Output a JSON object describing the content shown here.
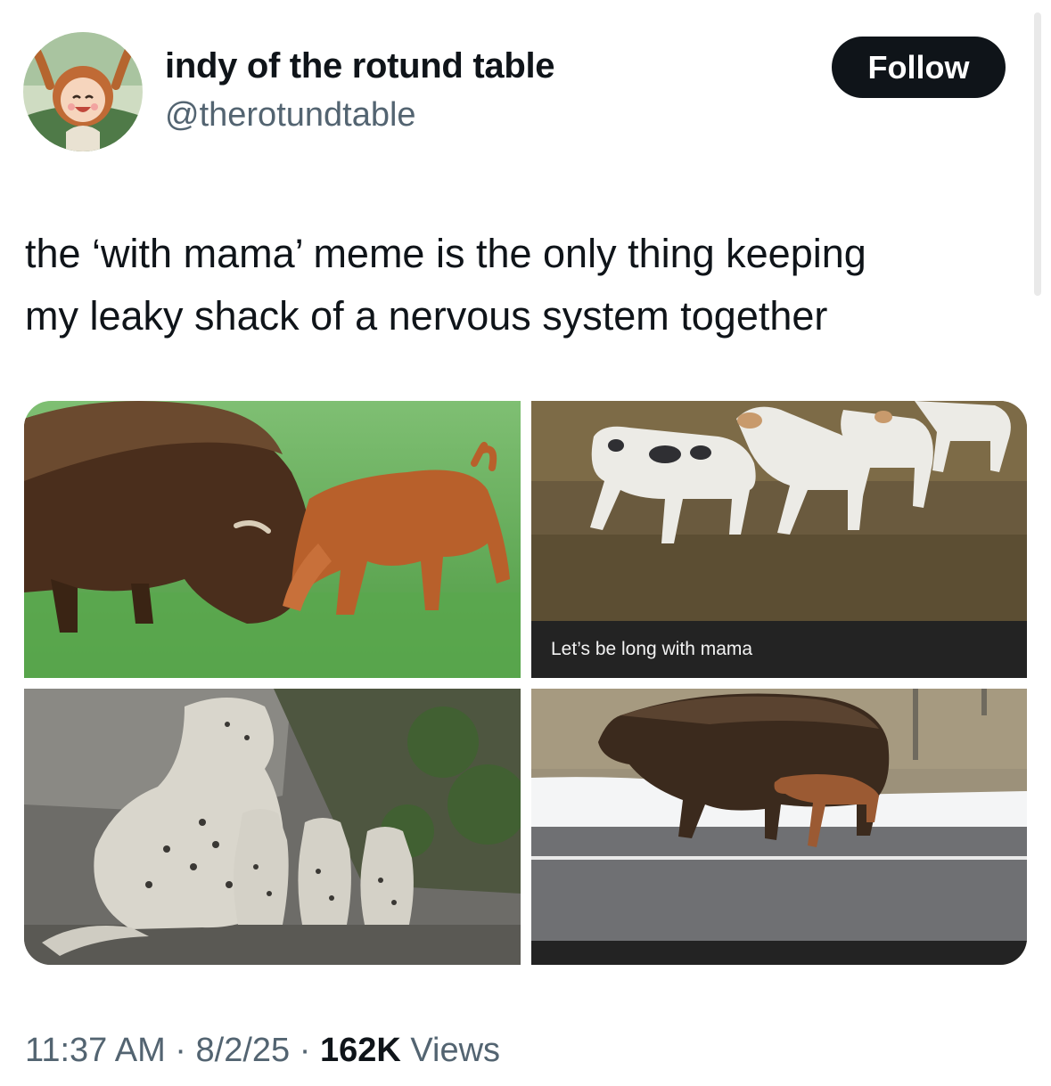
{
  "author": {
    "display_name": "indy of the rotund table",
    "handle": "@therotundtable",
    "avatar_icon": "cartoon-girl-avatar-icon"
  },
  "follow_label": "Follow",
  "tweet": {
    "lines": [
      "the ‘with mama’ meme is the only thing keeping",
      "my leaky shack of a nervous system together"
    ]
  },
  "media": {
    "images": [
      {
        "subject": "bison calf butting heads with mama bison on grass"
      },
      {
        "subject": "hound dogs walking in a line",
        "caption": "Let’s be long with mama"
      },
      {
        "subject": "snow leopard mother with three cubs on rocks"
      },
      {
        "subject": "bison calf walking under mama bison on a road with snow"
      }
    ]
  },
  "meta": {
    "time": "11:37 AM",
    "sep1": " · ",
    "date": "8/2/25",
    "sep2": " · ",
    "views_count": "162K",
    "views_label": " Views"
  }
}
